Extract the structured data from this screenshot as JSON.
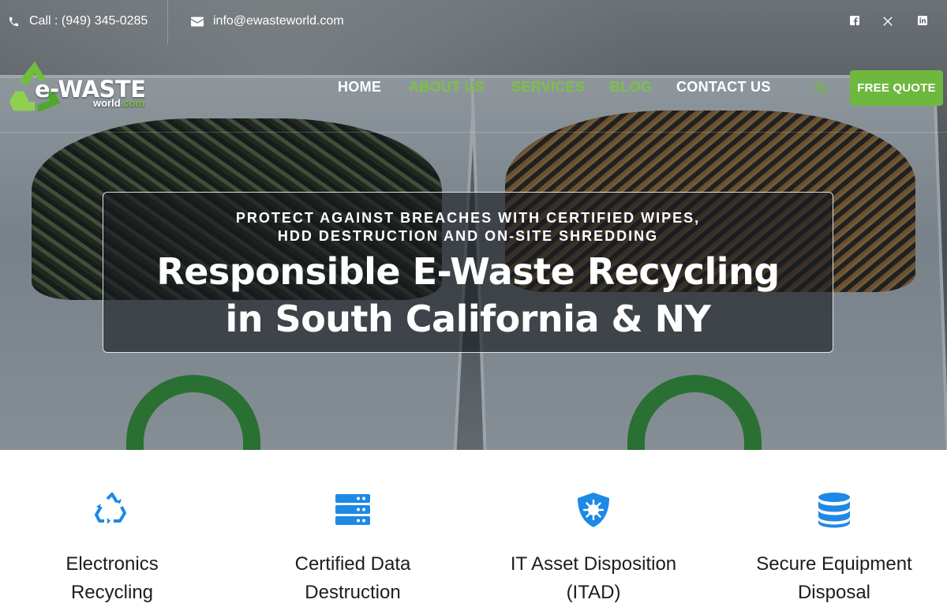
{
  "topbar": {
    "phone": "Call : (949) 345-0285",
    "email": "info@ewasteworld.com",
    "social": [
      "facebook-icon",
      "x-icon",
      "linkedin-icon"
    ]
  },
  "logo": {
    "main": "e-WASTE",
    "sub_a": "world",
    "sub_b": ".com"
  },
  "nav": {
    "items": [
      {
        "label": "HOME",
        "color": "#ffffff"
      },
      {
        "label": "ABOUT US",
        "color": "#7cc143"
      },
      {
        "label": "SERVICES",
        "color": "#7cc143"
      },
      {
        "label": "BLOG",
        "color": "#7cc143"
      },
      {
        "label": "CONTACT US",
        "color": "#ffffff"
      }
    ],
    "search_icon": "search-icon",
    "cta": "FREE QUOTE"
  },
  "hero": {
    "kicker_line1": "PROTECT AGAINST BREACHES WITH CERTIFIED WIPES,",
    "kicker_line2": "HDD DESTRUCTION AND ON-SITE SHREDDING",
    "title_line1": "Responsible E-Waste Recycling",
    "title_line2": "in South California & NY"
  },
  "services": [
    {
      "icon": "recycle-icon",
      "line1": "Electronics",
      "line2": "Recycling"
    },
    {
      "icon": "server-icon",
      "line1": "Certified Data",
      "line2": "Destruction"
    },
    {
      "icon": "shield-virus-icon",
      "line1": "IT Asset Disposition",
      "line2": "(ITAD)"
    },
    {
      "icon": "database-icon",
      "line1": "Secure Equipment",
      "line2": "Disposal"
    }
  ],
  "colors": {
    "accent_green": "#6fb83f",
    "icon_blue": "#1e88e5"
  }
}
